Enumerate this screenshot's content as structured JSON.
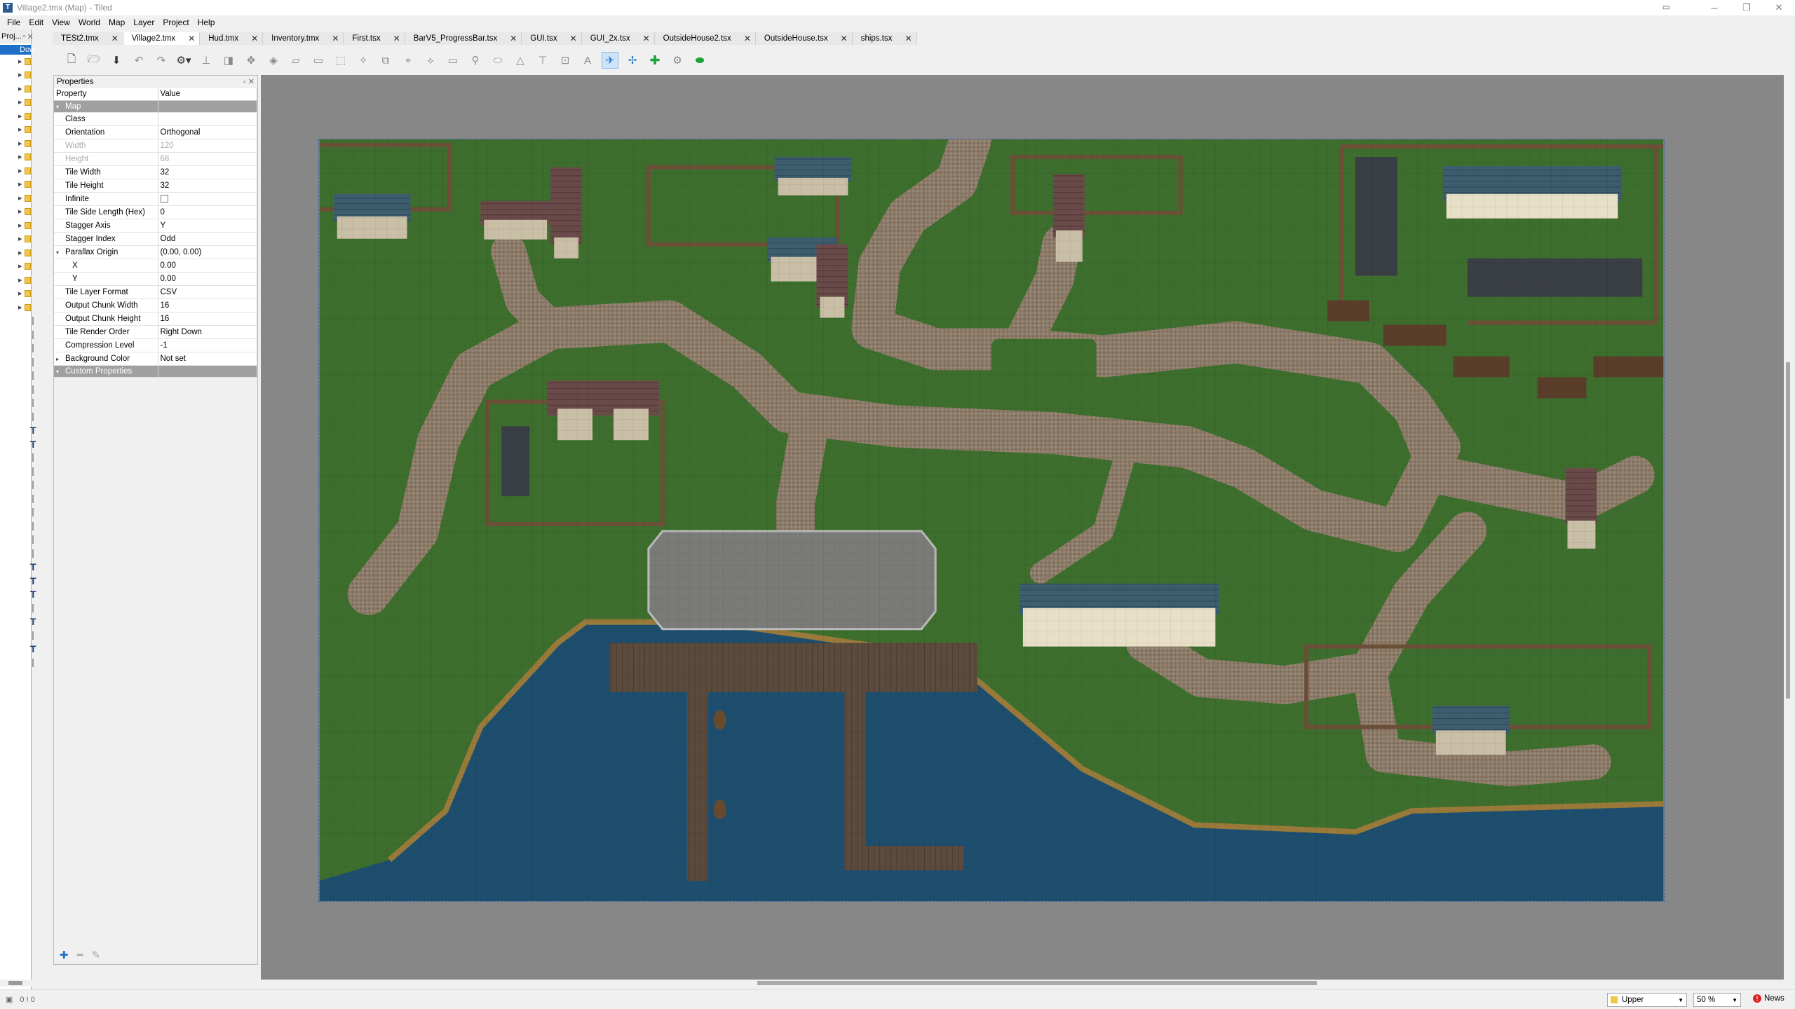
{
  "window": {
    "title": "Village2.tmx (Map) - Tiled",
    "app_icon": "tiled-icon",
    "controls": [
      "minimize",
      "maximize",
      "close"
    ]
  },
  "menu": [
    "File",
    "Edit",
    "View",
    "World",
    "Map",
    "Layer",
    "Project",
    "Help"
  ],
  "tabs": [
    {
      "label": "TESt2.tmx",
      "active": false
    },
    {
      "label": "Village2.tmx",
      "active": true
    },
    {
      "label": "Hud.tmx",
      "active": false
    },
    {
      "label": "Inventory.tmx",
      "active": false
    },
    {
      "label": "First.tsx",
      "active": false
    },
    {
      "label": "BarV5_ProgressBar.tsx",
      "active": false
    },
    {
      "label": "GUI.tsx",
      "active": false
    },
    {
      "label": "GUI_2x.tsx",
      "active": false
    },
    {
      "label": "OutsideHouse2.tsx",
      "active": false
    },
    {
      "label": "OutsideHouse.tsx",
      "active": false
    },
    {
      "label": "ships.tsx",
      "active": false
    }
  ],
  "project_panel": {
    "title": "Proj...",
    "root_label": "Dow"
  },
  "properties_panel": {
    "title": "Properties",
    "col_property": "Property",
    "col_value": "Value",
    "rows": [
      {
        "name": "Map",
        "value": "",
        "type": "group",
        "expander": "▾"
      },
      {
        "name": "Class",
        "value": ""
      },
      {
        "name": "Orientation",
        "value": "Orthogonal"
      },
      {
        "name": "Width",
        "value": "120",
        "disabled": true
      },
      {
        "name": "Height",
        "value": "68",
        "disabled": true
      },
      {
        "name": "Tile Width",
        "value": "32"
      },
      {
        "name": "Tile Height",
        "value": "32"
      },
      {
        "name": "Infinite",
        "value": "",
        "checkbox": true
      },
      {
        "name": "Tile Side Length (Hex)",
        "value": "0"
      },
      {
        "name": "Stagger Axis",
        "value": "Y"
      },
      {
        "name": "Stagger Index",
        "value": "Odd"
      },
      {
        "name": "Parallax Origin",
        "value": "(0.00, 0.00)",
        "expander": "▾"
      },
      {
        "name": "X",
        "value": "0.00",
        "indent": true
      },
      {
        "name": "Y",
        "value": "0.00",
        "indent": true
      },
      {
        "name": "Tile Layer Format",
        "value": "CSV"
      },
      {
        "name": "Output Chunk Width",
        "value": "16"
      },
      {
        "name": "Output Chunk Height",
        "value": "16"
      },
      {
        "name": "Tile Render Order",
        "value": "Right Down"
      },
      {
        "name": "Compression Level",
        "value": "-1"
      },
      {
        "name": "Background Color",
        "value": "Not set",
        "expander": "▸"
      },
      {
        "name": "Custom Properties",
        "value": "",
        "type": "group",
        "expander": "▾"
      }
    ]
  },
  "status": {
    "layer": "Upper",
    "zoom": "50 %",
    "news": "News",
    "counts": "0 ! 0"
  },
  "colors": {
    "grass": "#3d6e2d",
    "path": "#8a7866",
    "water": "#1e4e6e",
    "canvas_bg": "#878787",
    "accent": "#1e6fc8"
  }
}
